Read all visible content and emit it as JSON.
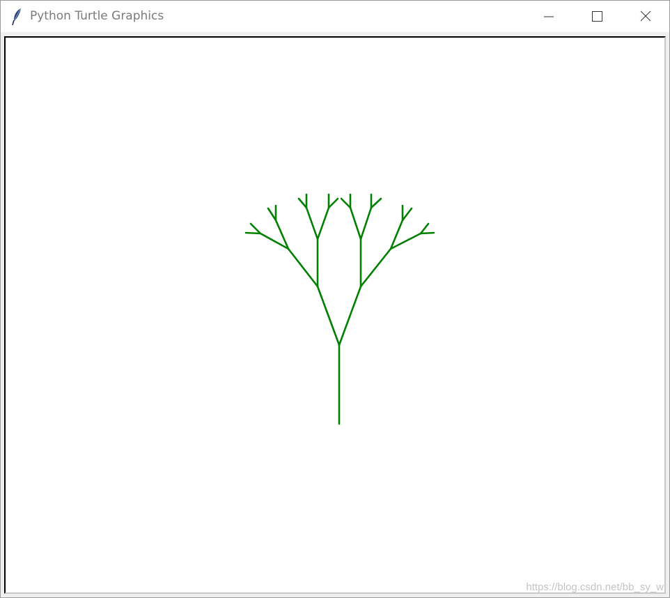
{
  "window": {
    "title": "Python Turtle Graphics",
    "app_icon": "feather-icon",
    "controls": {
      "minimize_icon": "minimize-icon",
      "maximize_icon": "maximize-icon",
      "close_icon": "close-icon"
    }
  },
  "canvas": {
    "background": "#ffffff",
    "pen_color": "#008000",
    "drawing": "fractal-tree"
  },
  "watermark": "https://blog.csdn.net/bb_sy_w"
}
